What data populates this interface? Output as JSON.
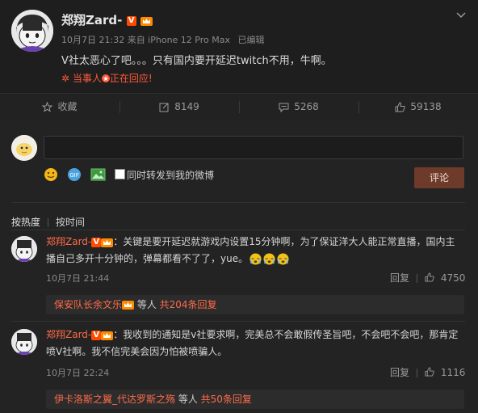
{
  "post": {
    "author": "郑翔Zard-",
    "v_badge": "V",
    "meta": "10月7日 21:32 来自 iPhone 12 Pro Max",
    "edited": "已编辑",
    "content": "V社太恶心了吧。。。只有国内要开延迟twitch不用，牛啊。",
    "live_icon": "✲",
    "live_prefix": "当事人",
    "live_suffix": "正在回应!"
  },
  "actions": {
    "favorite": "收藏",
    "repost_count": "8149",
    "comment_count": "5268",
    "like_count": "59138"
  },
  "composer": {
    "checkbox_label": "同时转发到我的微博",
    "submit": "评论"
  },
  "sort_tabs": {
    "hot": "按热度",
    "time": "按时间"
  },
  "comments": [
    {
      "author": "郑翔Zard-",
      "text_line1": "：关键是要开延迟就游戏内设置15分钟啊，为了保证洋大人能正常直播，国内主",
      "text_line2": "播自己多开十分钟的，弹幕都看不了了，yue。",
      "time": "10月7日 21:44",
      "reply_label": "回复",
      "like_count": "4750",
      "reply_user": "保安队长余文乐",
      "reply_mid": " 等人 ",
      "reply_total": "共204条回复"
    },
    {
      "author": "郑翔Zard-",
      "text_line1": "：我收到的通知是v社要求啊，完美总不会敢假传圣旨吧，不会吧不会吧，那肯定",
      "text_line2": "喷V社啊。我不信完美会因为怕被喷骗人。",
      "time": "10月7日 22:24",
      "reply_label": "回复",
      "like_count": "1116",
      "reply_user": "伊卡洛斯之翼_代达罗斯之殇",
      "reply_mid": " 等人 ",
      "reply_total": "共50条回复"
    }
  ],
  "colors": {
    "background": "#1e1e1e",
    "accent": "#ff6a4a",
    "submit_bg": "#6e3a2a"
  }
}
